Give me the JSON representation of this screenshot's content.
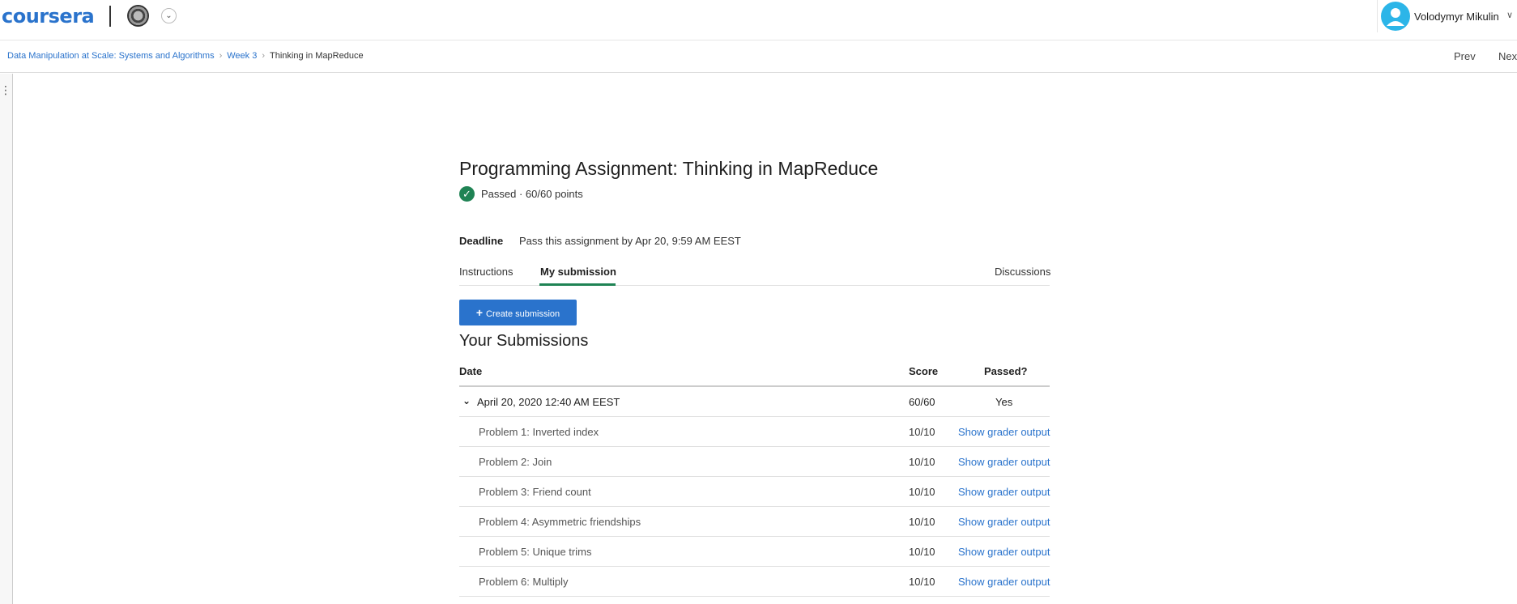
{
  "header": {
    "logo": "coursera",
    "uni_dropdown_icon": "chevron-down-icon",
    "user_name": "Volodymyr Mikulin",
    "user_chevron": "∨"
  },
  "breadcrumb": {
    "course": "Data Manipulation at Scale: Systems and Algorithms",
    "week": "Week 3",
    "current": "Thinking in MapReduce",
    "sep": "›"
  },
  "nav": {
    "prev": "Prev",
    "next": "Next"
  },
  "assignment": {
    "title": "Programming Assignment: Thinking in MapReduce",
    "status": "Passed · 60/60 points",
    "deadline_label": "Deadline",
    "deadline_value": "Pass this assignment by Apr 20, 9:59 AM EEST"
  },
  "tabs": {
    "instructions": "Instructions",
    "submission": "My submission",
    "discussions": "Discussions"
  },
  "create_button": "Create submission",
  "submissions": {
    "title": "Your Submissions",
    "columns": {
      "date": "Date",
      "score": "Score",
      "passed": "Passed?"
    },
    "entry": {
      "date": "April 20, 2020 12:40 AM EEST",
      "score": "60/60",
      "passed": "Yes"
    },
    "link_label": "Show grader output",
    "problems": [
      {
        "name": "Problem 1: Inverted index",
        "score": "10/10"
      },
      {
        "name": "Problem 2: Join",
        "score": "10/10"
      },
      {
        "name": "Problem 3: Friend count",
        "score": "10/10"
      },
      {
        "name": "Problem 4: Asymmetric friendships",
        "score": "10/10"
      },
      {
        "name": "Problem 5: Unique trims",
        "score": "10/10"
      },
      {
        "name": "Problem 6: Multiply",
        "score": "10/10"
      }
    ]
  },
  "colors": {
    "brand": "#2a73cc",
    "success": "#1f8354",
    "avatar": "#2cb5e8"
  }
}
